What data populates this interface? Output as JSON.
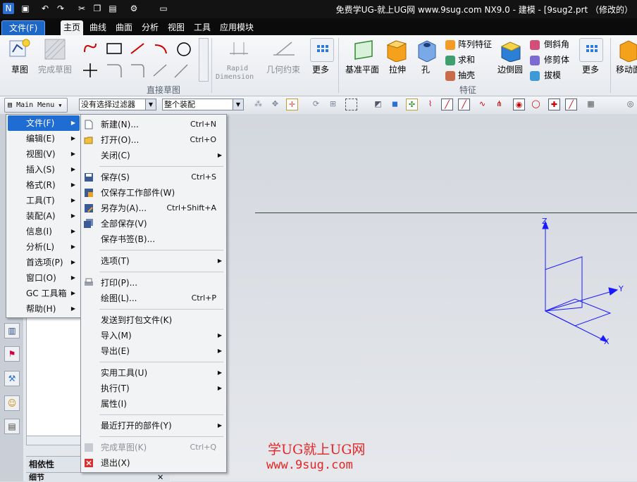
{
  "titlebar": {
    "title": "免费学UG-就上UG网 www.9sug.com NX9.0 - 建模 - [9sug2.prt （修改的）"
  },
  "ribbon_tabs": [
    {
      "label": "文件(F)"
    },
    {
      "label": "主页"
    },
    {
      "label": "曲线"
    },
    {
      "label": "曲面"
    },
    {
      "label": "分析"
    },
    {
      "label": "视图"
    },
    {
      "label": "工具"
    },
    {
      "label": "应用模块"
    }
  ],
  "ribbon": {
    "sketch": "草图",
    "finish_sketch": "完成草图",
    "direct_sketch_group": "直接草图",
    "rapid_dimension_1": "Rapid",
    "rapid_dimension_2": "Dimension",
    "geometric_constraint": "几何约束",
    "more": "更多",
    "datum_plane": "基准平面",
    "extrude": "拉伸",
    "hole": "孔",
    "pattern_feature": "阵列特征",
    "unite": "求和",
    "shell": "抽壳",
    "edge_blend": "边倒圆",
    "chamfer": "倒斜角",
    "trim_body": "修剪体",
    "draft": "拔模",
    "more2": "更多",
    "feature_group": "特征",
    "move": "移动面"
  },
  "toolbar": {
    "main_menu": "Main Menu",
    "filter": "没有选择过滤器",
    "assembly_scope": "整个装配"
  },
  "main_menu": [
    {
      "label": "文件(F)",
      "highlight": true
    },
    {
      "label": "编辑(E)"
    },
    {
      "label": "视图(V)"
    },
    {
      "label": "插入(S)"
    },
    {
      "label": "格式(R)"
    },
    {
      "label": "工具(T)"
    },
    {
      "label": "装配(A)"
    },
    {
      "label": "信息(I)"
    },
    {
      "label": "分析(L)"
    },
    {
      "label": "首选项(P)"
    },
    {
      "label": "窗口(O)"
    },
    {
      "label": "GC 工具箱"
    },
    {
      "label": "帮助(H)"
    }
  ],
  "file_menu": [
    {
      "label": "新建(N)...",
      "shortcut": "Ctrl+N",
      "icon": "new-file-icon"
    },
    {
      "label": "打开(O)...",
      "shortcut": "Ctrl+O",
      "icon": "open-folder-icon"
    },
    {
      "label": "关闭(C)",
      "submenu": true
    },
    {
      "label": "保存(S)",
      "shortcut": "Ctrl+S",
      "icon": "save-icon"
    },
    {
      "label": "仅保存工作部件(W)",
      "icon": "save-work-part-icon"
    },
    {
      "label": "另存为(A)...",
      "shortcut": "Ctrl+Shift+A",
      "icon": "save-as-icon"
    },
    {
      "label": "全部保存(V)",
      "icon": "save-all-icon"
    },
    {
      "label": "保存书签(B)..."
    },
    {
      "label": "选项(T)",
      "submenu": true
    },
    {
      "label": "打印(P)...",
      "icon": "printer-icon"
    },
    {
      "label": "绘图(L)...",
      "shortcut": "Ctrl+P"
    },
    {
      "label": "发送到打包文件(K)"
    },
    {
      "label": "导入(M)",
      "submenu": true
    },
    {
      "label": "导出(E)",
      "submenu": true
    },
    {
      "label": "实用工具(U)",
      "submenu": true
    },
    {
      "label": "执行(T)",
      "submenu": true
    },
    {
      "label": "属性(I)"
    },
    {
      "label": "最近打开的部件(Y)",
      "submenu": true
    },
    {
      "label": "完成草图(K)",
      "shortcut": "Ctrl+Q",
      "disabled": true,
      "icon": "finish-sketch-icon"
    },
    {
      "label": "退出(X)",
      "icon": "exit-icon"
    }
  ],
  "nav_panel": {
    "dependencies": "相依性",
    "details": "细节"
  },
  "viewport": {
    "axis_x": "X",
    "axis_y": "Y",
    "axis_z": "Z",
    "watermark_1": "学UG就上UG网",
    "watermark_2": "www.9sug.com"
  },
  "colors": {
    "accent": "#1d67c6",
    "axis": "#1a1aff",
    "watermark": "#e52525"
  }
}
